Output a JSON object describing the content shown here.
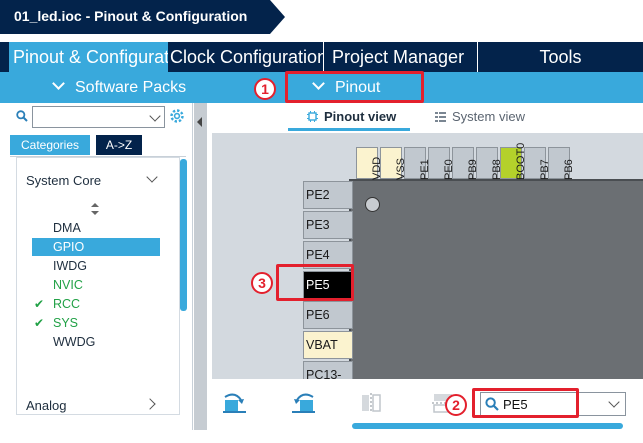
{
  "title": {
    "text": "01_led.ioc - Pinout & Configuration"
  },
  "top_tabs": [
    {
      "label": "Pinout & Configuration"
    },
    {
      "label": "Clock Configuration"
    },
    {
      "label": "Project Manager"
    },
    {
      "label": "Tools"
    }
  ],
  "sub_menus": {
    "software_packs": "Software Packs",
    "pinout": "Pinout"
  },
  "annotations": {
    "one": "1",
    "two": "2",
    "three": "3"
  },
  "left_panel": {
    "filter_value": "",
    "segments": {
      "categories": "Categories",
      "a_to_z": "A->Z"
    },
    "system_core": "System Core",
    "analog": "Analog",
    "items": [
      {
        "label": "DMA",
        "state": "normal"
      },
      {
        "label": "GPIO",
        "state": "selected"
      },
      {
        "label": "IWDG",
        "state": "normal"
      },
      {
        "label": "NVIC",
        "state": "green"
      },
      {
        "label": "RCC",
        "state": "checked"
      },
      {
        "label": "SYS",
        "state": "checked"
      },
      {
        "label": "WWDG",
        "state": "normal"
      }
    ]
  },
  "right_panel": {
    "view_tabs": {
      "pinout_view": "Pinout view",
      "system_view": "System view"
    },
    "top_pins": [
      "VDD",
      "VSS",
      "PE1",
      "PE0",
      "PB9",
      "PB8",
      "BOOT0",
      "PB7",
      "PB6"
    ],
    "left_pins": [
      "PE2",
      "PE3",
      "PE4",
      "PE5",
      "PE6",
      "VBAT",
      "PC13-"
    ],
    "search_value": "PE5"
  },
  "colors": {
    "navy": "#03234b",
    "accent_blue": "#39a9dc",
    "annotation_red": "#e3202d",
    "enabled_green": "#21a146",
    "pin_gray": "#c1c8cf",
    "power_pin_yellow": "#fbf3cf",
    "boot_pin_green": "#b4d12b",
    "selected_pin_black": "#000000"
  }
}
